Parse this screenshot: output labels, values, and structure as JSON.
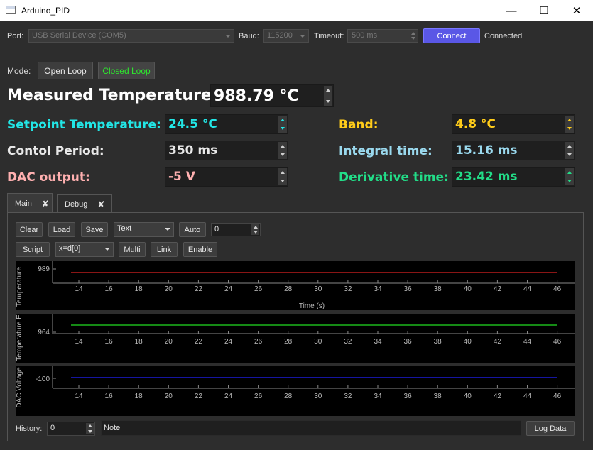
{
  "window": {
    "title": "Arduino_PID"
  },
  "connection": {
    "port_label": "Port:",
    "port_value": "USB Serial Device (COM5)",
    "baud_label": "Baud:",
    "baud_value": "115200",
    "timeout_label": "Timeout:",
    "timeout_value": "500 ms",
    "connect_label": "Connect",
    "status": "Connected"
  },
  "mode": {
    "label": "Mode:",
    "open_loop": "Open Loop",
    "closed_loop": "Closed Loop"
  },
  "readouts": {
    "measured_label": "Measured Temperature:",
    "measured_value": "988.79 °C",
    "setpoint_label": "Setpoint Temperature:",
    "setpoint_value": "24.5 °C",
    "period_label": "Contol Period:",
    "period_value": "350 ms",
    "dac_label": "DAC output:",
    "dac_value": "-5 V",
    "band_label": "Band:",
    "band_value": "4.8 °C",
    "integral_label": "Integral time:",
    "integral_value": "15.16 ms",
    "derivative_label": "Derivative time:",
    "derivative_value": "23.42 ms"
  },
  "colors": {
    "setpoint": "#22e6e6",
    "band": "#ffcc1a",
    "period": "#e8e8e8",
    "dac": "#ffb0b0",
    "integral": "#9ad9ee",
    "derivative": "#22dd88",
    "trace1": "#dd2222",
    "trace2": "#22dd22",
    "trace3": "#2222ff"
  },
  "tabs": [
    {
      "label": "Main"
    },
    {
      "label": "Debug"
    }
  ],
  "toolbar": {
    "clear": "Clear",
    "load": "Load",
    "save": "Save",
    "format": "Text",
    "auto": "Auto",
    "auto_value": "0",
    "script": "Script",
    "script_expr": "x=d[0]",
    "multi": "Multi",
    "link": "Link",
    "enable": "Enable"
  },
  "plots": [
    {
      "ylabel": "Temperature",
      "ytick": "989",
      "xlabel": "Time (s)",
      "value": 989
    },
    {
      "ylabel": "Temperature E",
      "ytick": "964",
      "xlabel": "",
      "value": 964
    },
    {
      "ylabel": "DAC Voltage",
      "ytick": "-100",
      "xlabel": "",
      "value": -100
    }
  ],
  "xticks": [
    "14",
    "16",
    "18",
    "20",
    "22",
    "24",
    "26",
    "28",
    "30",
    "32",
    "34",
    "36",
    "38",
    "40",
    "42",
    "44",
    "46"
  ],
  "footer": {
    "history_label": "History:",
    "history_value": "0",
    "note_placeholder": "Note",
    "log_data": "Log Data"
  }
}
